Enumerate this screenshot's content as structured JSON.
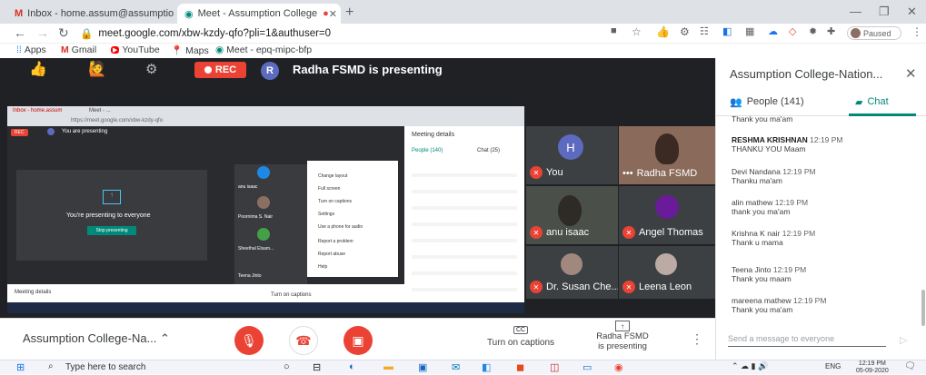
{
  "browser": {
    "tabs": [
      {
        "label": "Inbox - home.assum@assumptio",
        "icon": "gmail-icon"
      },
      {
        "label": "Meet - Assumption College",
        "icon": "meet-icon"
      }
    ],
    "url": "meet.google.com/xbw-kzdy-qfo?pli=1&authuser=0",
    "profile_status": "Paused",
    "bookmarks": [
      "Apps",
      "Gmail",
      "YouTube",
      "Maps",
      "Meet - epq-mipc-bfp"
    ]
  },
  "meet": {
    "rec_label": "REC",
    "presenter_initial": "R",
    "presenting_text": "Radha FSMD is presenting",
    "inner": {
      "tab1": "Inbox - home.assum",
      "tab2": "Meet - ...",
      "url": "https://meet.google.com/xbw-kzdy-qfo",
      "rec": "REC",
      "you_presenting": "You are presenting",
      "presenting_everyone": "You're presenting to everyone",
      "stop_button": "Stop presenting",
      "meeting_details": "Meeting details",
      "turn_on_captions": "Turn on captions",
      "panel_title": "Meeting details",
      "people_tab": "People (140)",
      "chat_tab": "Chat (25)",
      "menu": [
        "Change layout",
        "Full screen",
        "Turn on captions",
        "Settings",
        "Use a phone for audio",
        "Report a problem",
        "Report abuse",
        "Help"
      ],
      "names": [
        "anu isaac",
        "Poornima S. Nair",
        "Sheethal Elsam...",
        "Teena Jinto"
      ]
    },
    "tiles": [
      {
        "name": "You",
        "initial": "H"
      },
      {
        "name": "Radha FSMD"
      },
      {
        "name": "anu isaac"
      },
      {
        "name": "Angel Thomas"
      },
      {
        "name": "Dr. Susan Che..."
      },
      {
        "name": "Leena Leon"
      }
    ],
    "meeting_name": "Assumption College-Na...",
    "captions_label": "Turn on captions",
    "cc_label": "CC",
    "presenting_label": "Radha FSMD\nis presenting"
  },
  "panel": {
    "title": "Assumption College-Nation...",
    "people_tab": "People (141)",
    "chat_tab": "Chat",
    "messages": [
      {
        "sender": "",
        "time": "",
        "text": "Thank you ma'am"
      },
      {
        "sender": "RESHMA KRISHNAN",
        "time": "12:19 PM",
        "text": "THANKU YOU Maam"
      },
      {
        "sender": "Devi Nandana",
        "time": "12:19 PM",
        "text": "Thanku ma'am"
      },
      {
        "sender": "alin mathew",
        "time": "12:19 PM",
        "text": "thank you ma'am"
      },
      {
        "sender": "Krishna K nair",
        "time": "12:19 PM",
        "text": "Thank u mama"
      },
      {
        "sender": "Teena Jinto",
        "time": "12:19 PM",
        "text": "Thank you maam"
      },
      {
        "sender": "mareena mathew",
        "time": "12:19 PM",
        "text": "Thank you ma'am"
      }
    ],
    "send_placeholder": "Send a message to everyone"
  },
  "taskbar": {
    "search_placeholder": "Type here to search",
    "language": "ENG",
    "time": "12:19 PM",
    "date": "05-09-2020"
  },
  "colors": {
    "accent_green": "#00897b",
    "rec_red": "#ea4335",
    "dark_bg": "#202124"
  }
}
